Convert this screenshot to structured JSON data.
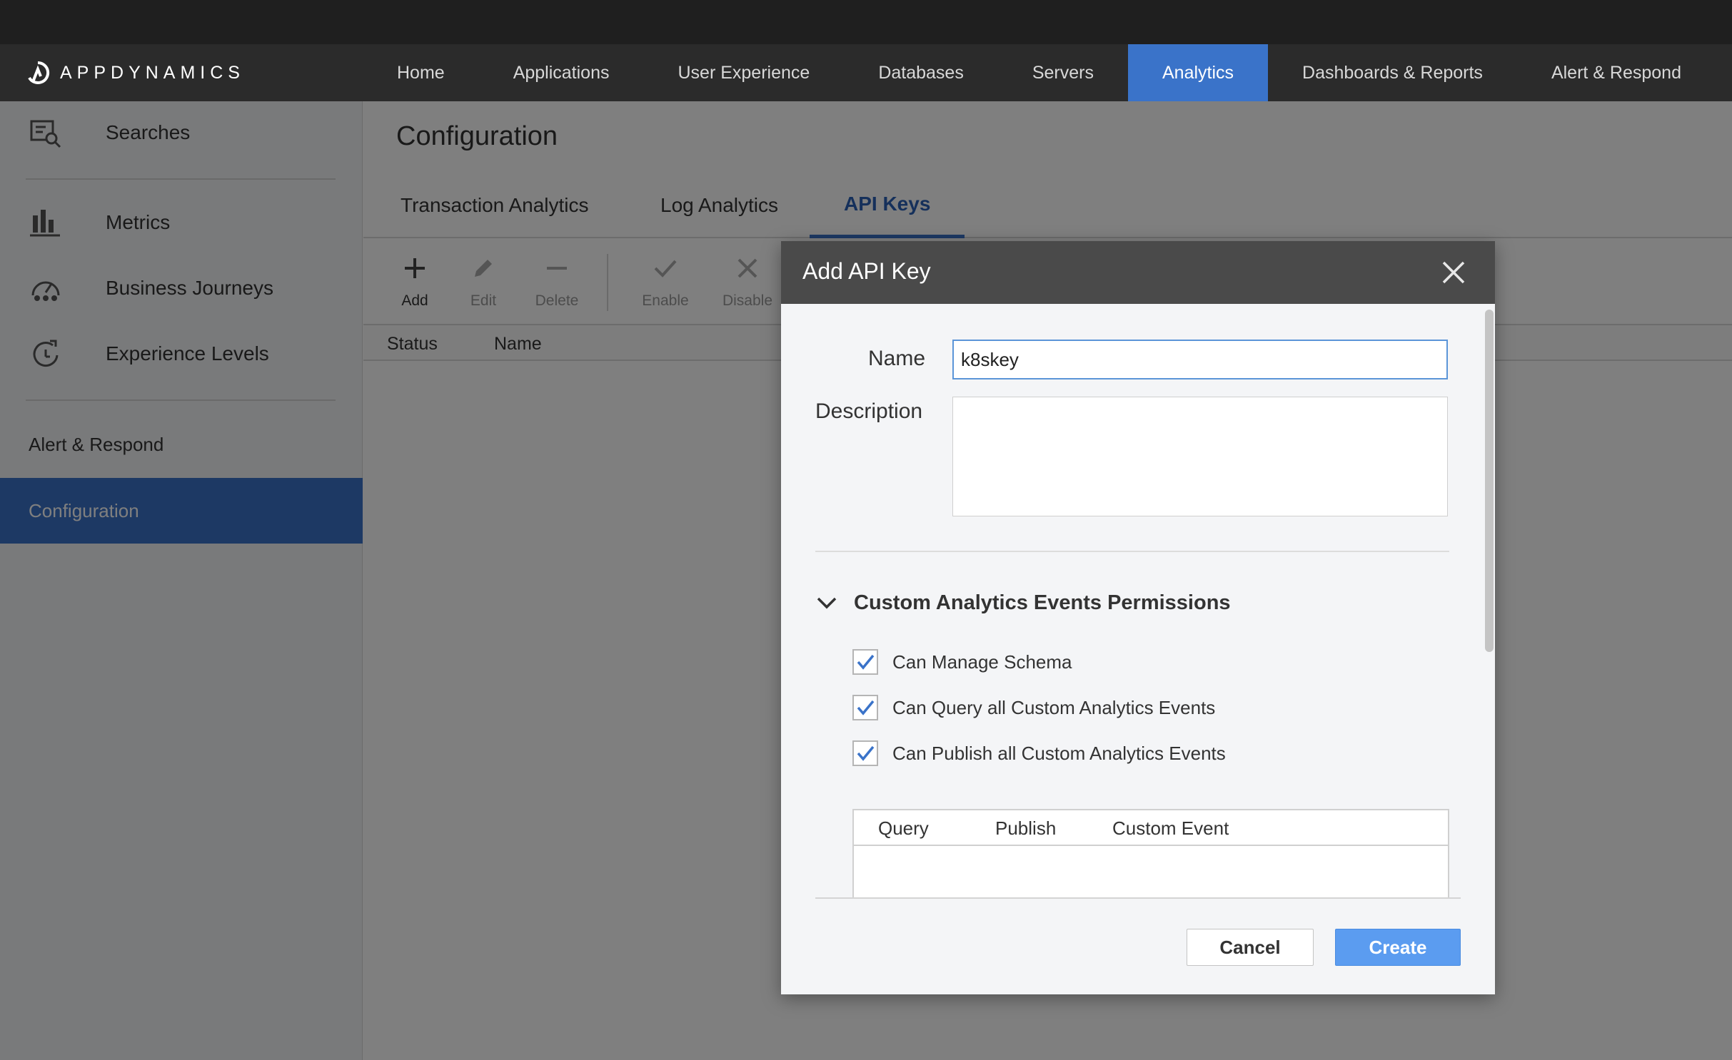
{
  "brand": {
    "logo_text": "APPDYNAMICS"
  },
  "top_nav": {
    "items": [
      {
        "label": "Home"
      },
      {
        "label": "Applications"
      },
      {
        "label": "User Experience"
      },
      {
        "label": "Databases"
      },
      {
        "label": "Servers"
      },
      {
        "label": "Analytics",
        "active": true
      },
      {
        "label": "Dashboards & Reports"
      },
      {
        "label": "Alert & Respond"
      }
    ]
  },
  "sidebar": {
    "items": [
      {
        "label": "Searches",
        "icon": "search-doc-icon"
      },
      {
        "label": "Metrics",
        "icon": "bar-chart-icon"
      },
      {
        "label": "Business Journeys",
        "icon": "journey-gauge-icon"
      },
      {
        "label": "Experience Levels",
        "icon": "experience-level-icon"
      },
      {
        "label": "Alert & Respond"
      },
      {
        "label": "Configuration",
        "active": true
      }
    ]
  },
  "page": {
    "title": "Configuration",
    "tabs": [
      {
        "label": "Transaction Analytics"
      },
      {
        "label": "Log Analytics"
      },
      {
        "label": "API Keys",
        "active": true
      }
    ],
    "toolbar": [
      {
        "label": "Add",
        "icon": "plus-icon",
        "enabled": true
      },
      {
        "label": "Edit",
        "icon": "pencil-icon",
        "enabled": false
      },
      {
        "label": "Delete",
        "icon": "minus-icon",
        "enabled": false
      },
      {
        "label": "Enable",
        "icon": "check-icon",
        "enabled": false
      },
      {
        "label": "Disable",
        "icon": "x-icon",
        "enabled": false
      }
    ],
    "grid_columns": [
      "Status",
      "Name"
    ]
  },
  "modal": {
    "title": "Add API Key",
    "name_label": "Name",
    "name_value": "k8skey",
    "description_label": "Description",
    "description_value": "",
    "section_title": "Custom Analytics Events Permissions",
    "checkboxes": [
      {
        "label": "Can Manage Schema",
        "checked": true
      },
      {
        "label": "Can Query all Custom Analytics Events",
        "checked": true
      },
      {
        "label": "Can Publish all Custom Analytics Events",
        "checked": true
      }
    ],
    "events_table_columns": [
      "Query",
      "Publish",
      "Custom Event"
    ],
    "cancel_label": "Cancel",
    "create_label": "Create"
  },
  "colors": {
    "accent": "#3a73c9",
    "create_button": "#5b9cf0",
    "check": "#3a73c9"
  }
}
